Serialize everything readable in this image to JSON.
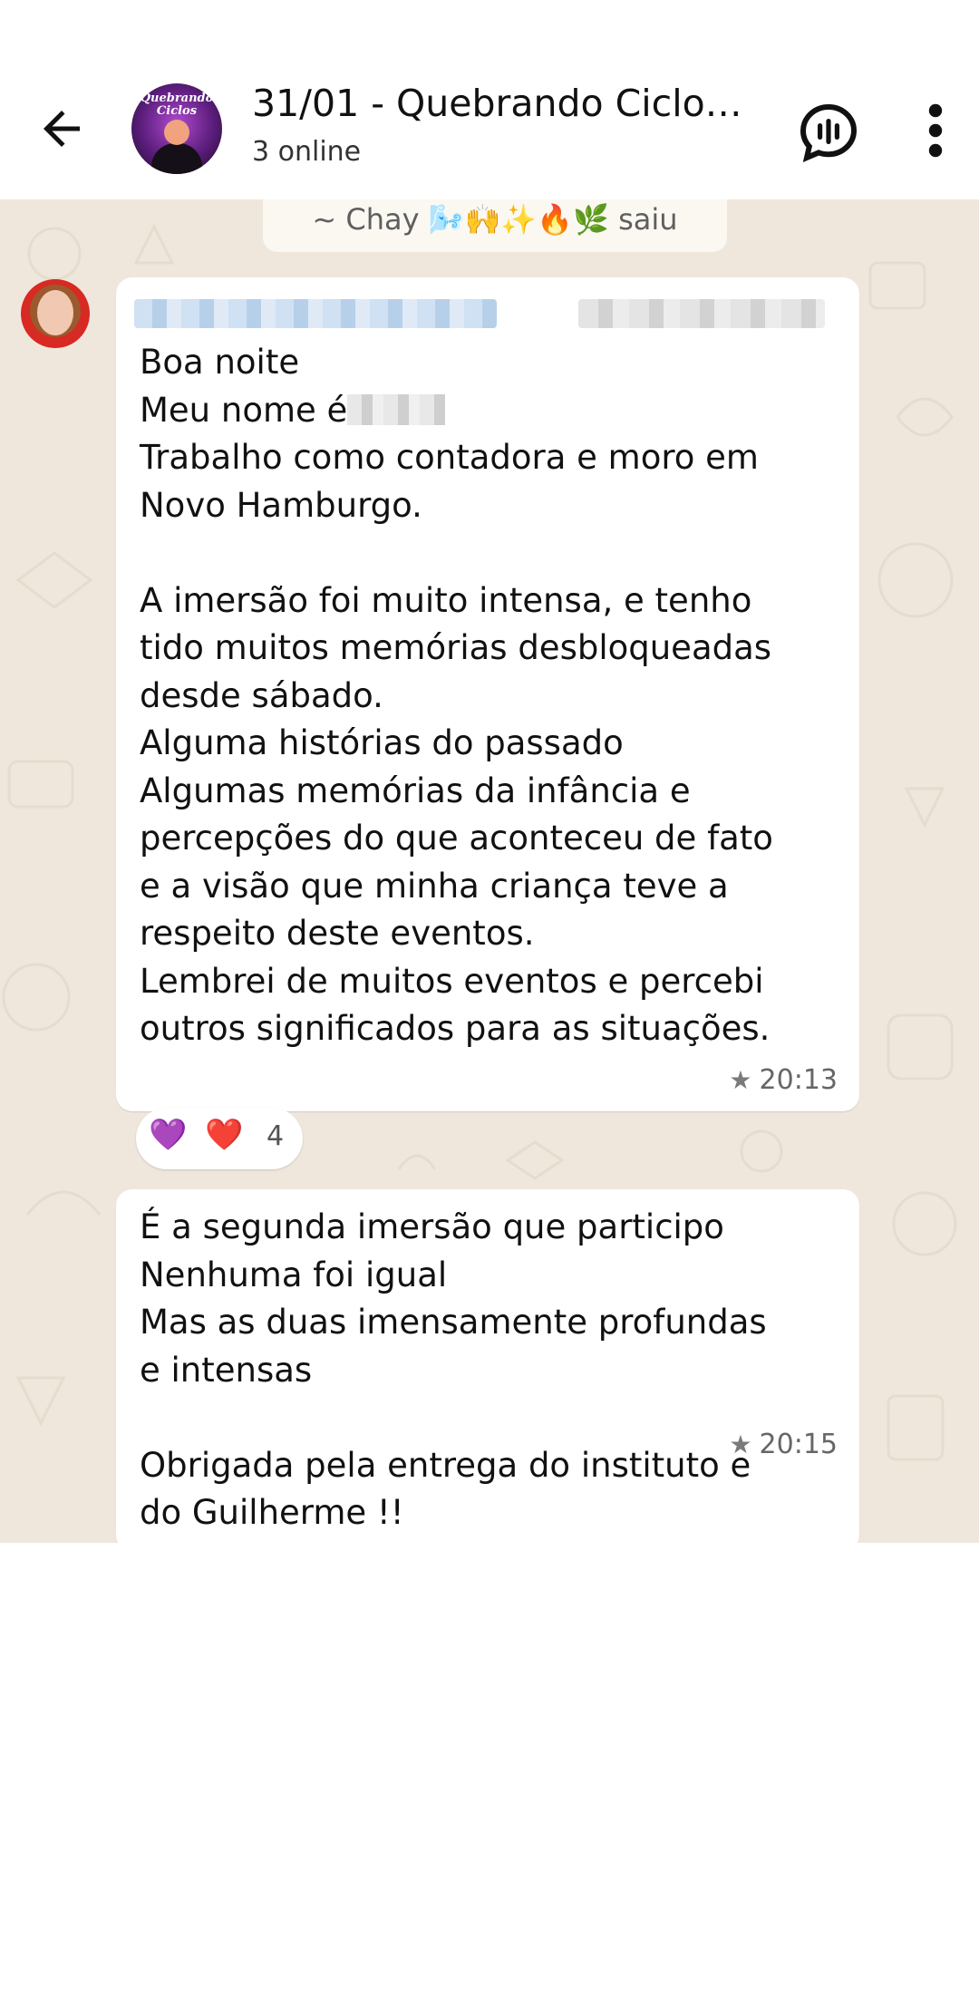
{
  "header": {
    "title": "31/01 - Quebrando Ciclo…",
    "subtitle": "3 online",
    "avatar_text": "Quebrando Ciclos",
    "back_icon": "arrow-left-icon",
    "voice_icon": "voice-chat-icon",
    "menu_icon": "more-vertical-icon"
  },
  "system_message": {
    "text": "~ Chay 🌬️🙌✨🔥🌿 saiu"
  },
  "messages": [
    {
      "line1": "Boa noite",
      "line2_prefix": "Meu nome é",
      "body": "Trabalho como contadora e moro em\nNovo Hamburgo.\n\nA imersão foi muito intensa, e tenho\ntido muitos memórias desbloqueadas\ndesde sábado.\nAlguma histórias do passado\nAlgumas memórias da infância e\npercepções do que aconteceu de fato\ne a visão que minha criança teve a\nrespeito deste eventos.\nLembrei de muitos eventos e percebi\noutros significados para as situações.",
      "time": "20:13",
      "starred": true,
      "reactions": {
        "emojis": [
          "💜",
          "❤️"
        ],
        "count": "4"
      }
    },
    {
      "body": "É a segunda imersão que participo\nNenhuma foi igual\nMas as duas imensamente profundas\ne intensas\n\nObrigada pela entrega do instituto e\ndo Guilherme !!",
      "time": "20:15",
      "starred": true
    }
  ],
  "colors": {
    "chat_background": "#efe7dc",
    "bubble": "#ffffff",
    "text": "#111111",
    "meta": "#666666"
  }
}
